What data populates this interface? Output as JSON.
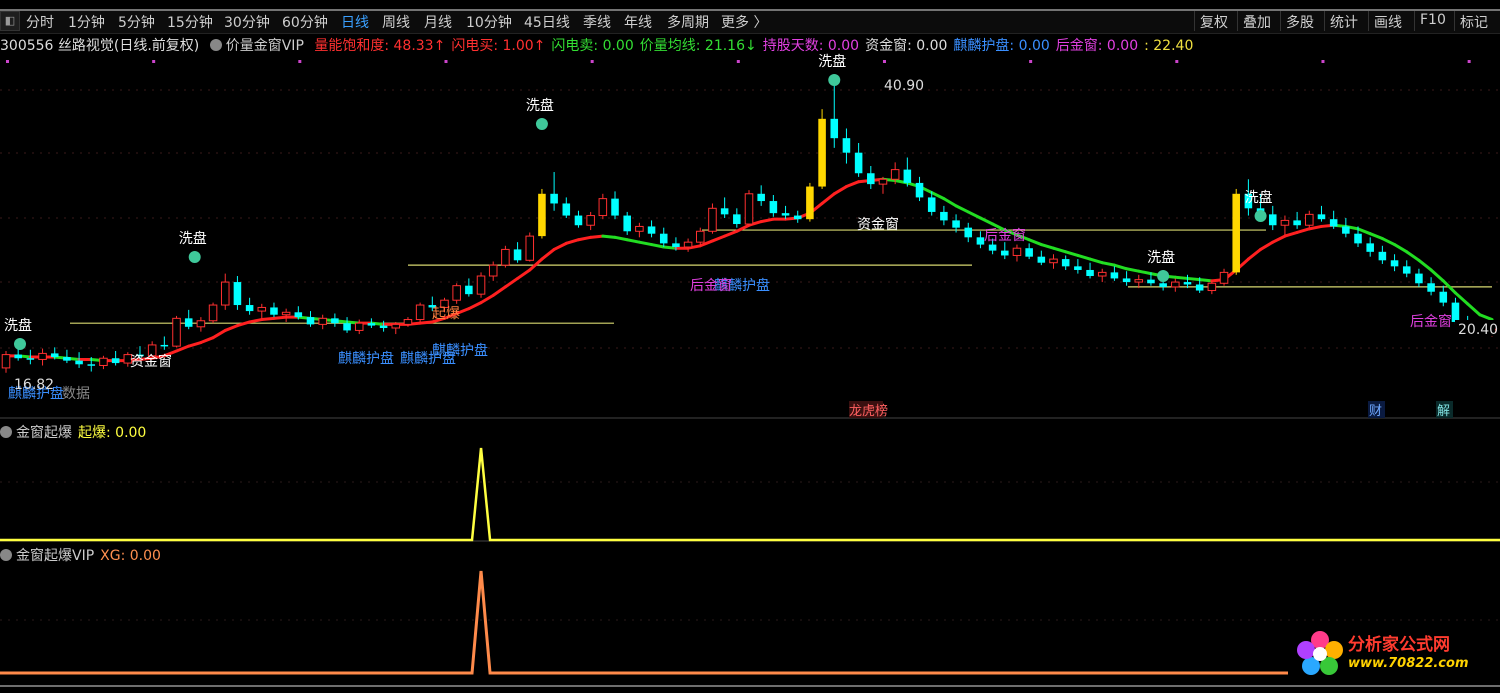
{
  "toolbar": {
    "tabs": [
      "分时",
      "1分钟",
      "5分钟",
      "15分钟",
      "30分钟",
      "60分钟",
      "日线",
      "周线",
      "月线",
      "10分钟",
      "45日线",
      "季线",
      "年线",
      "多周期",
      "更多 〉"
    ],
    "active_tab": "日线",
    "tools": [
      "复权",
      "叠加",
      "多股",
      "统计",
      "画线",
      "F10",
      "标记"
    ]
  },
  "legend": {
    "code_title": "300556 丝路视觉(日线.前复权)",
    "indicator": "价量金窗VIP",
    "items": [
      {
        "text": "量能饱和度: 48.33↑",
        "color": "#ff3030"
      },
      {
        "text": "闪电买: 1.00↑",
        "color": "#ff3030"
      },
      {
        "text": "闪电卖: 0.00",
        "color": "#33dd33"
      },
      {
        "text": "价量均线: 21.16↓",
        "color": "#33dd33"
      },
      {
        "text": "持股天数: 0.00",
        "color": "#e040e0"
      },
      {
        "text": "资金窗: 0.00",
        "color": "#dddddd"
      },
      {
        "text": "麒麟护盘: 0.00",
        "color": "#3a8fff"
      },
      {
        "text": "后金窗: 0.00",
        "color": "#e040e0"
      },
      {
        "text": ": 22.40",
        "color": "#f0e040"
      }
    ]
  },
  "sub1": {
    "name": "金窗起爆",
    "label": "起爆: 0.00",
    "color": "#ffff40"
  },
  "sub2": {
    "name": "金窗起爆VIP",
    "label": "XG: 0.00",
    "color": "#ff9050"
  },
  "annotations": {
    "xipan": "洗盘",
    "zijinchuang": "资金窗",
    "houjinchuang": "后金窗",
    "qilin": "麒麟护盘",
    "qibao": "起爆",
    "high_label": "40.90",
    "low_label": "16.82",
    "last_label": "20.40",
    "data_label": "数据",
    "longhu": "龙虎榜",
    "cai": "财",
    "jie": "解"
  },
  "watermark": {
    "title": "分析家公式网",
    "url": "www.70822.com"
  },
  "colors": {
    "up": "#ff3030",
    "down": "#00ffff",
    "ma_up": "#ff2020",
    "ma_down": "#22dd22",
    "yellow": "#ffd700"
  },
  "chart_data": {
    "type": "candlestick",
    "high": 40.9,
    "low": 16.82,
    "last": 20.4,
    "ma_last": 21.16,
    "bars": [
      [
        17.2,
        18.6,
        16.8,
        18.3
      ],
      [
        18.3,
        19.5,
        17.8,
        18.0
      ],
      [
        18.0,
        18.7,
        17.5,
        17.9
      ],
      [
        17.9,
        18.8,
        17.4,
        18.4
      ],
      [
        18.4,
        18.9,
        17.9,
        18.1
      ],
      [
        18.1,
        18.7,
        17.6,
        17.8
      ],
      [
        17.8,
        18.5,
        17.2,
        17.5
      ],
      [
        17.5,
        18.1,
        16.9,
        17.4
      ],
      [
        17.4,
        18.2,
        17.1,
        18.0
      ],
      [
        18.0,
        18.6,
        17.4,
        17.6
      ],
      [
        17.6,
        18.5,
        17.3,
        18.3
      ],
      [
        18.3,
        19.0,
        17.9,
        18.2
      ],
      [
        18.2,
        19.4,
        18.0,
        19.1
      ],
      [
        19.1,
        19.8,
        18.7,
        19.0
      ],
      [
        19.0,
        21.5,
        18.9,
        21.3
      ],
      [
        21.3,
        22.0,
        20.4,
        20.6
      ],
      [
        20.6,
        21.4,
        20.2,
        21.1
      ],
      [
        21.1,
        22.6,
        20.9,
        22.4
      ],
      [
        22.4,
        25.0,
        22.0,
        24.3
      ],
      [
        24.3,
        24.8,
        22.0,
        22.4
      ],
      [
        22.4,
        23.0,
        21.6,
        21.9
      ],
      [
        21.9,
        22.5,
        21.3,
        22.2
      ],
      [
        22.2,
        22.6,
        21.4,
        21.6
      ],
      [
        21.6,
        22.1,
        21.0,
        21.8
      ],
      [
        21.8,
        22.3,
        21.2,
        21.4
      ],
      [
        21.4,
        21.9,
        20.6,
        20.8
      ],
      [
        20.8,
        21.6,
        20.4,
        21.3
      ],
      [
        21.3,
        21.7,
        20.6,
        20.9
      ],
      [
        20.9,
        21.4,
        20.1,
        20.3
      ],
      [
        20.3,
        21.2,
        20.0,
        20.9
      ],
      [
        20.9,
        21.3,
        20.5,
        20.7
      ],
      [
        20.7,
        21.1,
        20.2,
        20.5
      ],
      [
        20.5,
        21.0,
        20.0,
        20.8
      ],
      [
        20.8,
        21.4,
        20.6,
        21.2
      ],
      [
        21.2,
        22.6,
        21.0,
        22.4
      ],
      [
        22.4,
        23.1,
        21.9,
        22.2
      ],
      [
        22.2,
        23.0,
        21.8,
        22.8
      ],
      [
        22.8,
        24.2,
        22.5,
        24.0
      ],
      [
        24.0,
        24.6,
        23.1,
        23.3
      ],
      [
        23.3,
        25.1,
        23.0,
        24.8
      ],
      [
        24.8,
        26.0,
        24.4,
        25.7
      ],
      [
        25.7,
        27.3,
        25.5,
        27.0
      ],
      [
        27.0,
        27.6,
        25.9,
        26.1
      ],
      [
        26.1,
        28.4,
        26.0,
        28.1
      ],
      [
        28.1,
        32.0,
        27.9,
        31.6
      ],
      [
        31.6,
        33.4,
        30.2,
        30.8
      ],
      [
        30.8,
        31.3,
        29.6,
        29.8
      ],
      [
        29.8,
        30.2,
        28.8,
        29.0
      ],
      [
        29.0,
        30.1,
        28.6,
        29.8
      ],
      [
        29.8,
        31.6,
        29.5,
        31.2
      ],
      [
        31.2,
        31.8,
        29.5,
        29.8
      ],
      [
        29.8,
        30.1,
        28.2,
        28.5
      ],
      [
        28.5,
        29.2,
        28.0,
        28.9
      ],
      [
        28.9,
        29.4,
        28.0,
        28.3
      ],
      [
        28.3,
        28.8,
        27.2,
        27.5
      ],
      [
        27.5,
        28.0,
        26.9,
        27.2
      ],
      [
        27.2,
        27.9,
        26.8,
        27.6
      ],
      [
        27.6,
        28.8,
        27.3,
        28.5
      ],
      [
        28.5,
        30.8,
        28.3,
        30.4
      ],
      [
        30.4,
        31.3,
        29.6,
        29.9
      ],
      [
        29.9,
        30.4,
        28.8,
        29.1
      ],
      [
        29.1,
        31.9,
        28.9,
        31.6
      ],
      [
        31.6,
        32.3,
        30.6,
        31.0
      ],
      [
        31.0,
        31.5,
        29.7,
        30.0
      ],
      [
        30.0,
        30.6,
        29.5,
        29.8
      ],
      [
        29.8,
        30.2,
        29.2,
        29.5
      ],
      [
        29.5,
        32.5,
        29.3,
        32.2
      ],
      [
        32.2,
        38.6,
        32.0,
        37.8
      ],
      [
        37.8,
        40.9,
        35.4,
        36.2
      ],
      [
        36.2,
        37.0,
        34.1,
        35.0
      ],
      [
        35.0,
        35.8,
        33.0,
        33.3
      ],
      [
        33.3,
        33.9,
        32.0,
        32.4
      ],
      [
        32.4,
        33.0,
        31.6,
        32.8
      ],
      [
        32.8,
        34.2,
        32.4,
        33.6
      ],
      [
        33.6,
        34.6,
        32.2,
        32.5
      ],
      [
        32.5,
        33.0,
        31.0,
        31.3
      ],
      [
        31.3,
        31.8,
        29.8,
        30.1
      ],
      [
        30.1,
        30.6,
        29.0,
        29.4
      ],
      [
        29.4,
        29.9,
        28.4,
        28.8
      ],
      [
        28.8,
        29.2,
        27.6,
        28.0
      ],
      [
        28.0,
        28.5,
        27.1,
        27.4
      ],
      [
        27.4,
        27.9,
        26.6,
        26.9
      ],
      [
        26.9,
        27.6,
        26.2,
        26.5
      ],
      [
        26.5,
        27.4,
        26.0,
        27.1
      ],
      [
        27.1,
        27.5,
        26.2,
        26.4
      ],
      [
        26.4,
        26.9,
        25.7,
        25.9
      ],
      [
        25.9,
        26.6,
        25.4,
        26.2
      ],
      [
        26.2,
        26.5,
        25.3,
        25.6
      ],
      [
        25.6,
        26.2,
        25.0,
        25.3
      ],
      [
        25.3,
        25.9,
        24.6,
        24.8
      ],
      [
        24.8,
        25.4,
        24.3,
        25.1
      ],
      [
        25.1,
        25.6,
        24.4,
        24.6
      ],
      [
        24.6,
        25.2,
        24.0,
        24.3
      ],
      [
        24.3,
        24.9,
        23.8,
        24.5
      ],
      [
        24.5,
        25.1,
        24.0,
        24.2
      ],
      [
        24.2,
        24.8,
        23.6,
        23.9
      ],
      [
        23.9,
        24.6,
        23.5,
        24.3
      ],
      [
        24.3,
        24.9,
        23.8,
        24.1
      ],
      [
        24.1,
        24.7,
        23.4,
        23.6
      ],
      [
        23.6,
        24.4,
        23.3,
        24.2
      ],
      [
        24.2,
        25.4,
        24.0,
        25.1
      ],
      [
        25.1,
        32.0,
        24.9,
        31.6
      ],
      [
        31.6,
        32.8,
        29.8,
        30.4
      ],
      [
        30.4,
        31.6,
        29.6,
        29.9
      ],
      [
        29.9,
        30.6,
        28.6,
        29.0
      ],
      [
        29.0,
        29.8,
        28.2,
        29.4
      ],
      [
        29.4,
        30.1,
        28.7,
        29.0
      ],
      [
        29.0,
        30.2,
        28.8,
        29.9
      ],
      [
        29.9,
        30.6,
        29.3,
        29.5
      ],
      [
        29.5,
        30.2,
        28.7,
        28.9
      ],
      [
        28.9,
        29.6,
        28.0,
        28.3
      ],
      [
        28.3,
        28.9,
        27.2,
        27.5
      ],
      [
        27.5,
        28.0,
        26.4,
        26.8
      ],
      [
        26.8,
        27.3,
        25.8,
        26.1
      ],
      [
        26.1,
        26.6,
        25.2,
        25.6
      ],
      [
        25.6,
        26.1,
        24.7,
        25.0
      ],
      [
        25.0,
        25.4,
        23.9,
        24.2
      ],
      [
        24.2,
        24.7,
        23.2,
        23.5
      ],
      [
        23.5,
        24.0,
        22.3,
        22.6
      ],
      [
        22.6,
        23.0,
        20.8,
        21.0
      ],
      [
        21.0,
        21.5,
        20.1,
        20.4
      ],
      [
        20.4,
        21.0,
        19.9,
        20.2
      ],
      [
        20.2,
        20.8,
        19.8,
        20.4
      ]
    ],
    "ma": [
      18.2,
      18.2,
      18.1,
      18.1,
      18.1,
      18.0,
      17.9,
      17.9,
      17.8,
      17.8,
      17.8,
      17.9,
      18.0,
      18.2,
      18.6,
      19.0,
      19.3,
      19.7,
      20.3,
      20.7,
      21.0,
      21.2,
      21.3,
      21.4,
      21.4,
      21.3,
      21.2,
      21.1,
      21.0,
      20.9,
      20.9,
      20.8,
      20.8,
      20.8,
      20.9,
      21.0,
      21.3,
      21.7,
      22.1,
      22.6,
      23.2,
      23.9,
      24.6,
      25.3,
      26.2,
      27.0,
      27.5,
      27.8,
      28.0,
      28.1,
      28.0,
      27.8,
      27.6,
      27.4,
      27.2,
      27.1,
      27.1,
      27.3,
      27.7,
      28.1,
      28.5,
      29.0,
      29.3,
      29.5,
      29.5,
      29.6,
      30.0,
      30.8,
      31.6,
      32.2,
      32.6,
      32.7,
      32.8,
      32.7,
      32.5,
      32.2,
      31.7,
      31.2,
      30.6,
      30.1,
      29.6,
      29.1,
      28.6,
      28.2,
      27.8,
      27.4,
      27.1,
      26.8,
      26.5,
      26.2,
      25.9,
      25.7,
      25.4,
      25.2,
      25.0,
      24.8,
      24.7,
      24.6,
      24.5,
      24.4,
      24.5,
      25.3,
      26.2,
      27.0,
      27.6,
      28.1,
      28.4,
      28.7,
      28.9,
      29.0,
      28.9,
      28.7,
      28.3,
      27.9,
      27.4,
      26.8,
      26.1,
      25.3,
      24.4,
      23.4,
      22.5,
      21.6,
      21.2
    ],
    "sub_spike_index": 39
  }
}
